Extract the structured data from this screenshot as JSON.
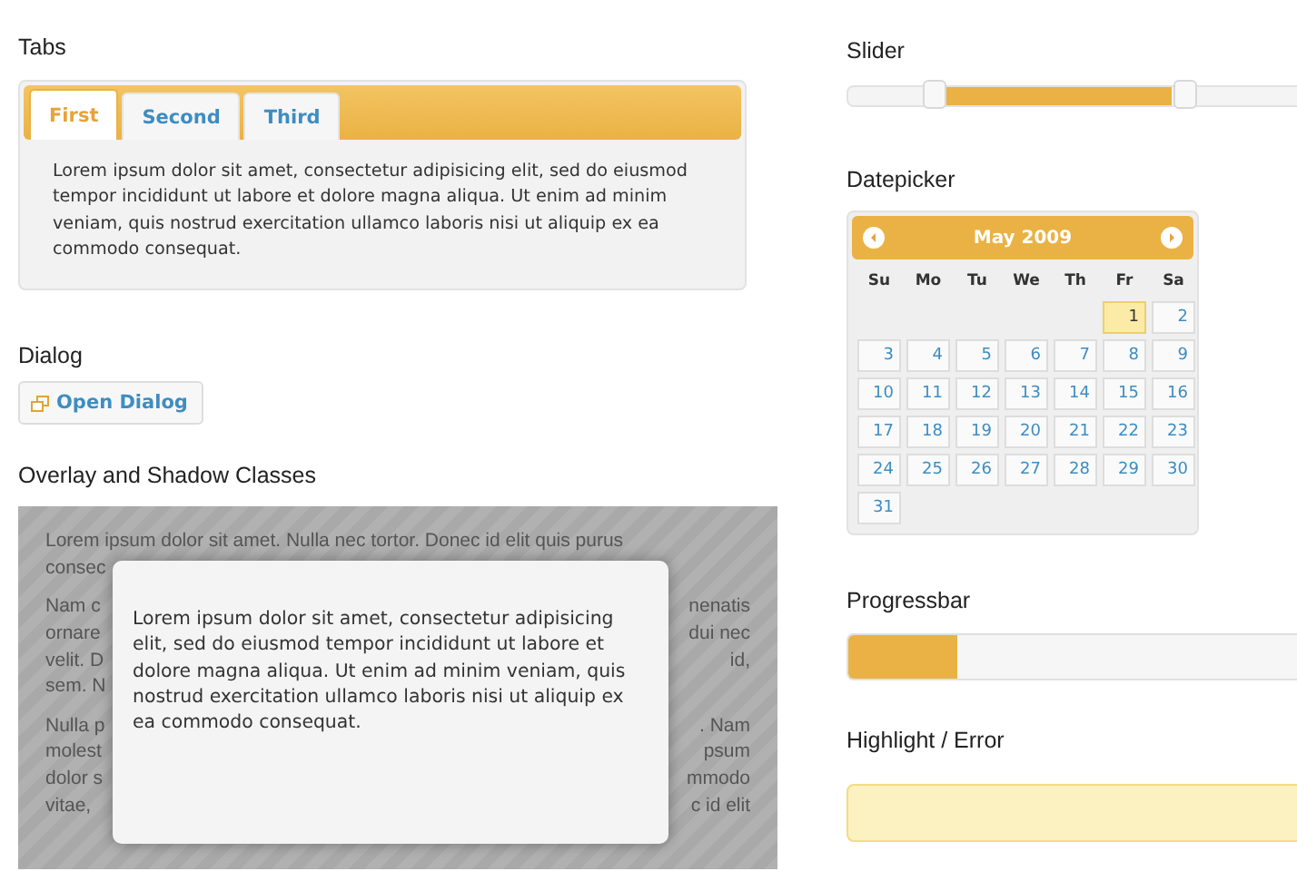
{
  "tabs_section": {
    "heading": "Tabs",
    "tabs": [
      {
        "label": "First",
        "selected": true
      },
      {
        "label": "Second",
        "selected": false
      },
      {
        "label": "Third",
        "selected": false
      }
    ],
    "panel_text": "Lorem ipsum dolor sit amet, consectetur adipisicing elit, sed do eiusmod tempor incididunt ut labore et dolore magna aliqua. Ut enim ad minim veniam, quis nostrud exercitation ullamco laboris nisi ut aliquip ex ea commodo consequat."
  },
  "dialog_section": {
    "heading": "Dialog",
    "button": "Open Dialog"
  },
  "overlay_section": {
    "heading": "Overlay and Shadow Classes",
    "paragraphs": [
      [
        {
          "left": "Lorem ipsum dolor sit amet. Nulla nec tortor. Donec id elit quis purus"
        },
        {
          "left": "consec"
        }
      ],
      [
        {
          "left": "Nam c",
          "right": "nenatis"
        },
        {
          "left": "ornare",
          "right": "dui nec"
        },
        {
          "left": "velit. D",
          "right": "id,"
        },
        {
          "left": "sem. N"
        }
      ],
      [
        {
          "left": "Nulla p",
          "right": ". Nam"
        },
        {
          "left": "molest",
          "right": "psum"
        },
        {
          "left": "dolor s",
          "right": "mmodo"
        },
        {
          "left": "vitae,",
          "right": "c id elit"
        }
      ]
    ],
    "dialog_text": "Lorem ipsum dolor sit amet, consectetur adipisicing elit, sed do eiusmod tempor incididunt ut labore et dolore magna aliqua. Ut enim ad minim veniam, quis nostrud exercitation ullamco laboris nisi ut aliquip ex ea commodo consequat."
  },
  "slider_section": {
    "heading": "Slider",
    "handles": [
      {
        "level": 0.18
      },
      {
        "level": 0.71
      }
    ]
  },
  "datepicker_section": {
    "heading": "Datepicker",
    "title": "May 2009",
    "weekdays": [
      "Su",
      "Mo",
      "Tu",
      "We",
      "Th",
      "Fr",
      "Sa"
    ],
    "weeks": [
      [
        {
          "kind": "blank"
        },
        {
          "kind": "blank"
        },
        {
          "kind": "blank"
        },
        {
          "kind": "blank"
        },
        {
          "kind": "blank"
        },
        {
          "label": "1",
          "today": true
        },
        {
          "label": "2",
          "today": false
        }
      ],
      [
        {
          "label": "3",
          "today": false
        },
        {
          "label": "4",
          "today": false
        },
        {
          "label": "5",
          "today": false
        },
        {
          "label": "6",
          "today": false
        },
        {
          "label": "7",
          "today": false
        },
        {
          "label": "8",
          "today": false
        },
        {
          "label": "9",
          "today": false
        }
      ],
      [
        {
          "label": "10",
          "today": false
        },
        {
          "label": "11",
          "today": false
        },
        {
          "label": "12",
          "today": false
        },
        {
          "label": "13",
          "today": false
        },
        {
          "label": "14",
          "today": false
        },
        {
          "label": "15",
          "today": false
        },
        {
          "label": "16",
          "today": false
        }
      ],
      [
        {
          "label": "17",
          "today": false
        },
        {
          "label": "18",
          "today": false
        },
        {
          "label": "19",
          "today": false
        },
        {
          "label": "20",
          "today": false
        },
        {
          "label": "21",
          "today": false
        },
        {
          "label": "22",
          "today": false
        },
        {
          "label": "23",
          "today": false
        }
      ],
      [
        {
          "label": "24",
          "today": false
        },
        {
          "label": "25",
          "today": false
        },
        {
          "label": "26",
          "today": false
        },
        {
          "label": "27",
          "today": false
        },
        {
          "label": "28",
          "today": false
        },
        {
          "label": "29",
          "today": false
        },
        {
          "label": "30",
          "today": false
        }
      ],
      [
        {
          "label": "31",
          "today": false
        }
      ]
    ]
  },
  "progress_section": {
    "heading": "Progressbar",
    "level": 0.23
  },
  "highlight_section": {
    "heading": "Highlight / Error"
  }
}
